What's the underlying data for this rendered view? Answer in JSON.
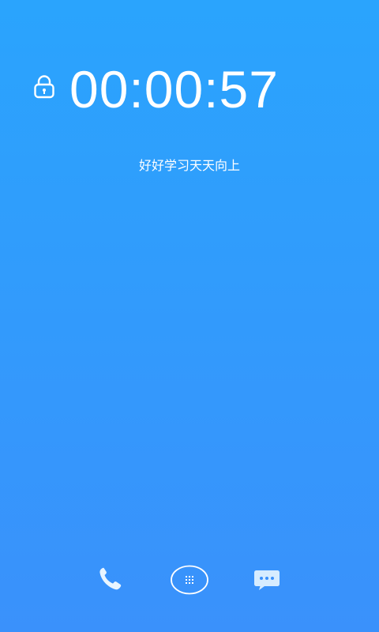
{
  "lock_screen": {
    "timer": "00:00:57",
    "motto": "好好学习天天向上",
    "lock_icon": "padlock-icon"
  },
  "dock": {
    "items": [
      {
        "icon": "phone-icon"
      },
      {
        "icon": "app-grid-icon"
      },
      {
        "icon": "message-bubble-icon"
      }
    ]
  },
  "colors": {
    "background_top": "#2aa4fd",
    "background_bottom": "#3a91fb",
    "foreground": "#ffffff"
  }
}
